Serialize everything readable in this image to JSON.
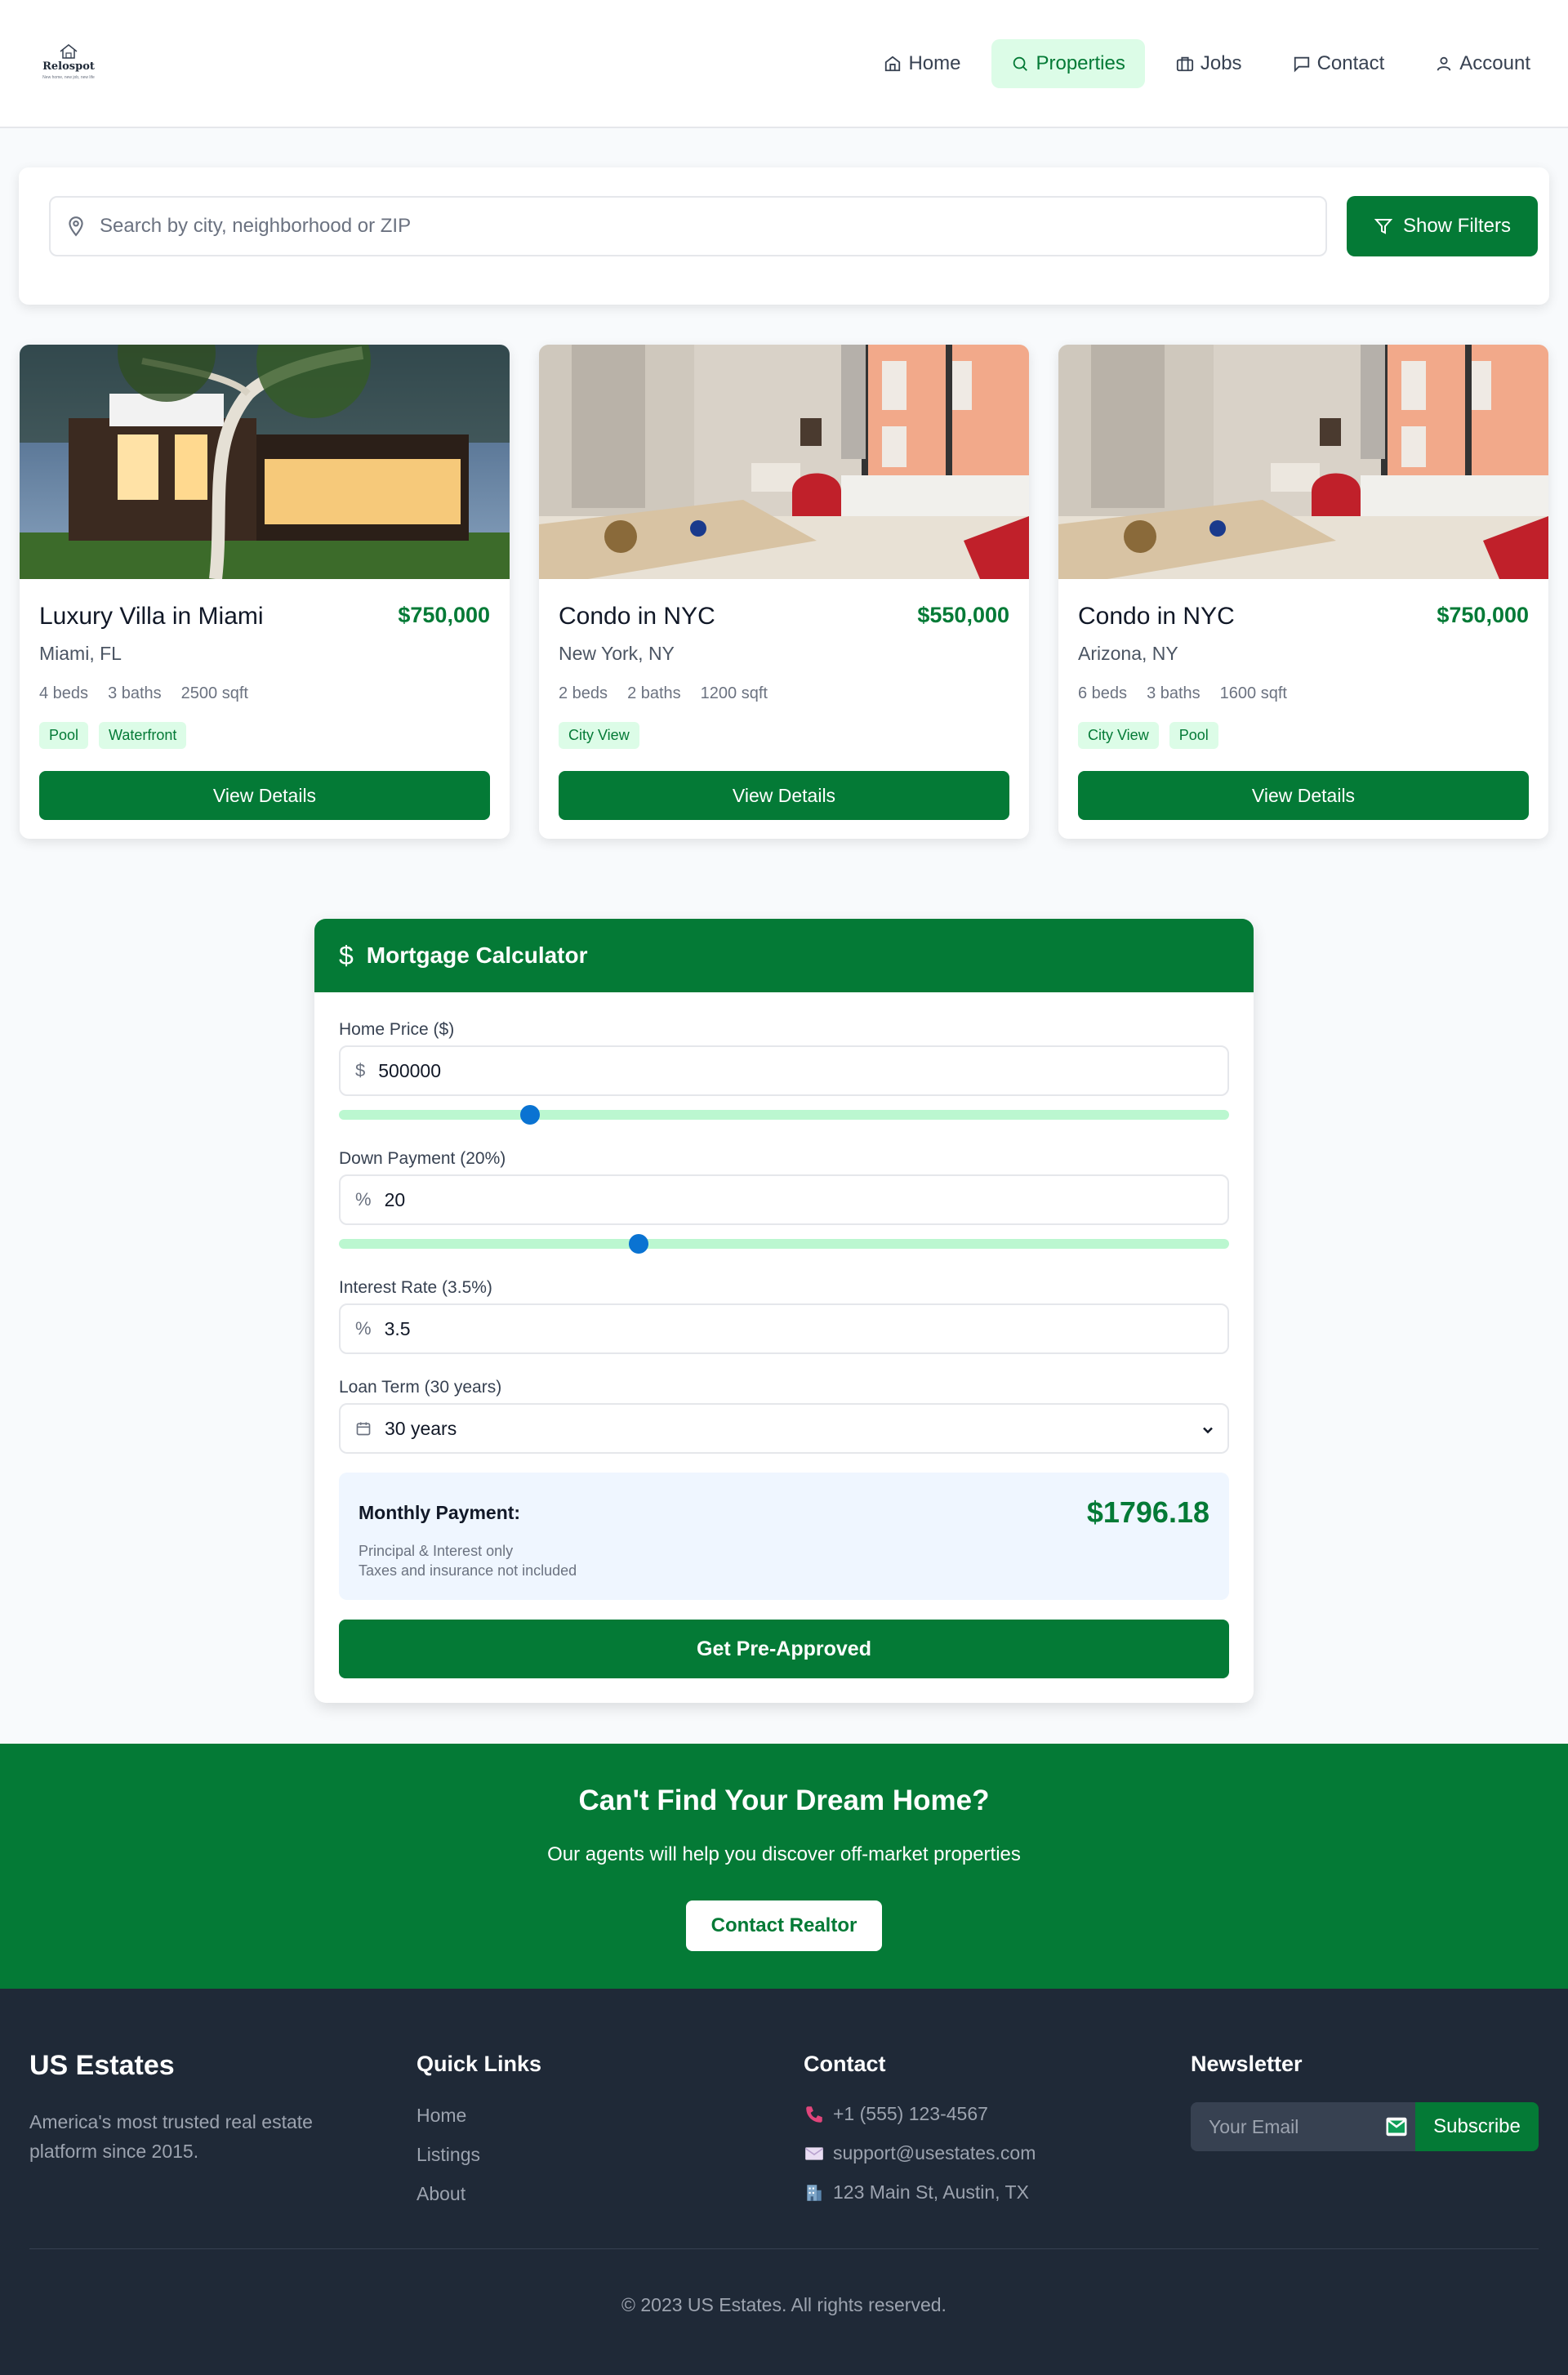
{
  "logo": {
    "name": "Relospot",
    "tagline": "New home, new job, new life"
  },
  "nav": [
    {
      "label": "Home",
      "icon": "home-icon",
      "active": false
    },
    {
      "label": "Properties",
      "icon": "search-icon",
      "active": true
    },
    {
      "label": "Jobs",
      "icon": "briefcase-icon",
      "active": false
    },
    {
      "label": "Contact",
      "icon": "message-icon",
      "active": false
    },
    {
      "label": "Account",
      "icon": "user-icon",
      "active": false
    }
  ],
  "search": {
    "placeholder": "Search by city, neighborhood or ZIP",
    "value": "",
    "filter_label": "Show Filters"
  },
  "properties": [
    {
      "title": "Luxury Villa in Miami",
      "price": "$750,000",
      "location": "Miami, FL",
      "beds": "4 beds",
      "baths": "3 baths",
      "sqft": "2500 sqft",
      "tags": [
        "Pool",
        "Waterfront"
      ],
      "button": "View Details",
      "image": "modern-house-photo"
    },
    {
      "title": "Condo in NYC",
      "price": "$550,000",
      "location": "New York, NY",
      "beds": "2 beds",
      "baths": "2 baths",
      "sqft": "1200 sqft",
      "tags": [
        "City View"
      ],
      "button": "View Details",
      "image": "living-room-photo"
    },
    {
      "title": "Condo in NYC",
      "price": "$750,000",
      "location": "Arizona, NY",
      "beds": "6 beds",
      "baths": "3 baths",
      "sqft": "1600 sqft",
      "tags": [
        "City View",
        "Pool"
      ],
      "button": "View Details",
      "image": "living-room-photo"
    }
  ],
  "mortgage": {
    "title": "Mortgage Calculator",
    "home_price_label": "Home Price ($)",
    "home_price_prefix": "$",
    "home_price_value": "500000",
    "home_price_slider_fraction": 0.215,
    "down_payment_label": "Down Payment (20%)",
    "down_payment_prefix": "%",
    "down_payment_value": "20",
    "down_payment_slider_fraction": 0.337,
    "interest_label": "Interest Rate (3.5%)",
    "interest_prefix": "%",
    "interest_value": "3.5",
    "term_label": "Loan Term (30 years)",
    "term_value": "30 years",
    "result_label": "Monthly Payment:",
    "result_value": "$1796.18",
    "note1": "Principal & Interest only",
    "note2": "Taxes and insurance not included",
    "button": "Get Pre-Approved"
  },
  "cta": {
    "title": "Can't Find Your Dream Home?",
    "subtitle": "Our agents will help you discover off-market properties",
    "button": "Contact Realtor"
  },
  "footer": {
    "brand": "US Estates",
    "description": "America's most trusted real estate platform since 2015.",
    "quick_links_title": "Quick Links",
    "quick_links": [
      "Home",
      "Listings",
      "About"
    ],
    "contact_title": "Contact",
    "phone": "+1 (555) 123-4567",
    "email": "support@usestates.com",
    "address": "123 Main St, Austin, TX",
    "newsletter_title": "Newsletter",
    "newsletter_placeholder": "Your Email",
    "newsletter_button": "Subscribe",
    "copyright": "© 2023 US Estates. All rights reserved."
  },
  "colors": {
    "brand_green": "#047a36",
    "light_green": "#dcfce7",
    "footer_bg": "#1f2937",
    "slider_thumb": "#0a73d2"
  }
}
